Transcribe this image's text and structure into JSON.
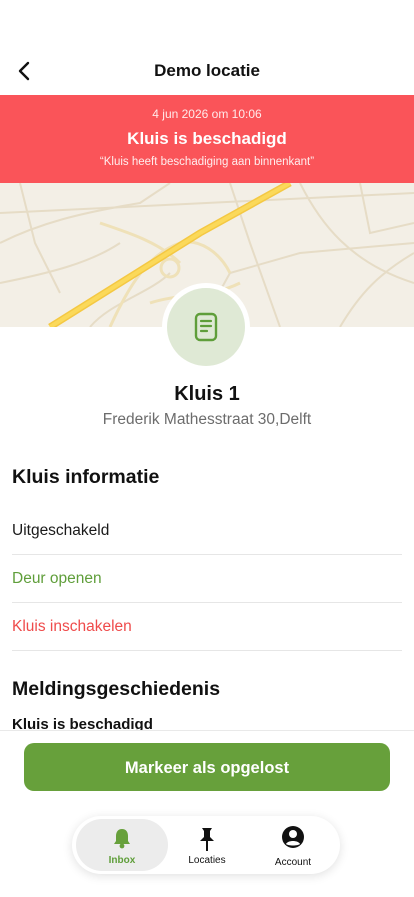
{
  "header": {
    "title": "Demo locatie",
    "back_icon": "chevron-left-icon"
  },
  "alert": {
    "timestamp": "4 jun 2026 om 10:06",
    "title": "Kluis is beschadigd",
    "quote": "“Kluis heeft beschadiging aan  binnenkant”",
    "color": "#fa5459"
  },
  "lock": {
    "icon": "document-icon",
    "name": "Kluis 1",
    "address": "Frederik Mathesstraat 30,Delft"
  },
  "info": {
    "title": "Kluis informatie",
    "rows": [
      {
        "label": "Uitgeschakeld",
        "color": "#1a1a1a"
      },
      {
        "label": "Deur openen",
        "color": "#5f9e3a"
      },
      {
        "label": "Kluis inschakelen",
        "color": "#ef4b4b"
      }
    ]
  },
  "history": {
    "title": "Meldingsgeschiedenis",
    "first_item": "Kluis is beschadigd"
  },
  "actions": {
    "resolve_label": "Markeer als opgelost",
    "resolve_color": "#67a03b"
  },
  "tabbar": {
    "tabs": [
      {
        "label": "Inbox",
        "icon": "bell-icon",
        "active": true
      },
      {
        "label": "Locaties",
        "icon": "pin-icon",
        "active": false
      },
      {
        "label": "Account",
        "icon": "account-icon",
        "active": false
      }
    ]
  }
}
